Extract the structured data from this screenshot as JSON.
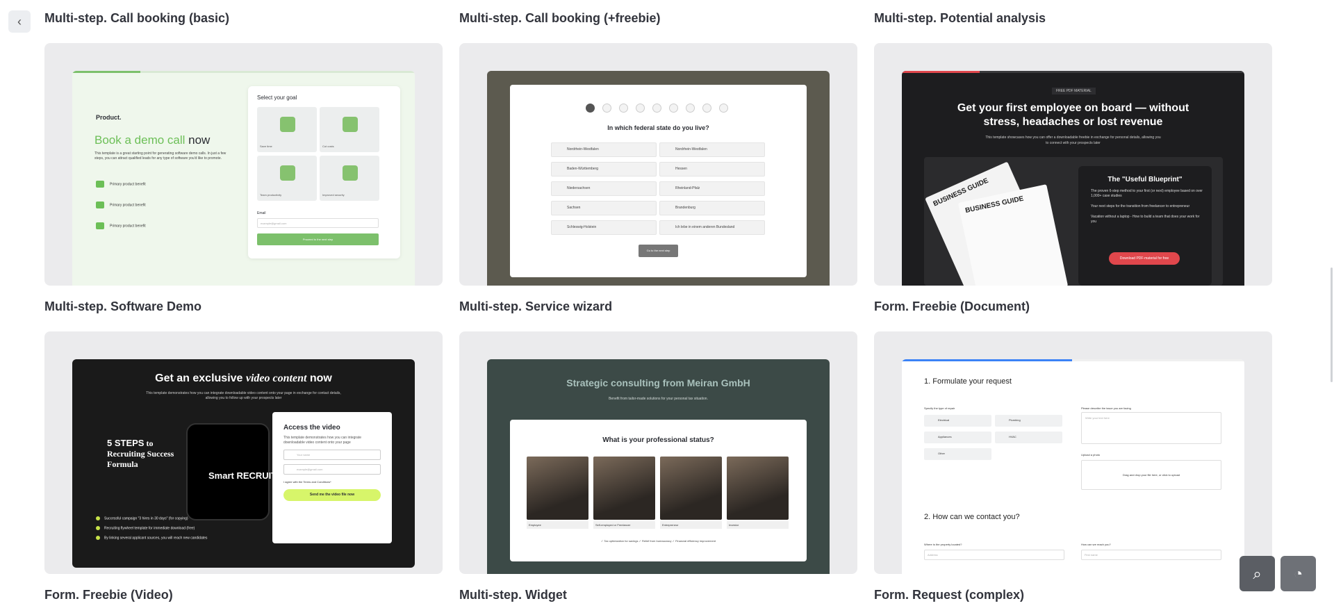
{
  "nav": {
    "back_icon": "chevron-left-icon",
    "back_glyph": "‹"
  },
  "titles_top": [
    "Multi-step. Call booking (basic)",
    "Multi-step. Call booking (+freebie)",
    "Multi-step. Potential analysis"
  ],
  "templates": [
    {
      "title": "Multi-step. Software Demo",
      "preview": {
        "logo": "Product.",
        "headline_pre": "Book a ",
        "headline_hl": "demo call",
        "headline_post": " now",
        "desc": "This template is a great starting point for generating software demo calls. In just a few steps, you can attract qualified leads for any type of software you'd like to promote.",
        "benefits": [
          "Primary product benefit",
          "Primary product benefit",
          "Primary product benefit"
        ],
        "panel_title": "Select your goal",
        "tiles": [
          "Save time",
          "Cut costs",
          "Team productivity",
          "Improved security"
        ],
        "email_label": "Email",
        "email_placeholder": "example@gmail.com",
        "cta": "Proceed to the next step"
      }
    },
    {
      "title": "Multi-step. Service wizard",
      "preview": {
        "question": "In which federal state do you live?",
        "steps": [
          "1",
          "2",
          "3",
          "4",
          "5",
          "6",
          "7",
          "8",
          "9"
        ],
        "options": [
          "Nordrhein-Westfalen",
          "Nordrhein-Westfalen",
          "Baden-Württemberg",
          "Hessen",
          "Niedersachsen",
          "Rheinland-Pfalz",
          "Sachsen",
          "Brandenburg",
          "Schleswig-Holstein",
          "Ich lebe in einem anderen Bundesland"
        ],
        "next": "Go to the next step"
      }
    },
    {
      "title": "Form. Freebie (Document)",
      "preview": {
        "tag": "FREE PDF MATERIAL",
        "headline": "Get your first employee on board — without stress, headaches or lost revenue",
        "sub": "This template showcases how you can offer a downloadable freebie in exchange for personal details, allowing you to connect with your prospects later",
        "card_title": "The \"Useful Blueprint\"",
        "bullets": [
          "The proven 6-step method to your first (or next) employee based on over 1,000+ case studies",
          "Your next steps for the transition from freelancer to entrepreneur",
          "Vacation without a laptop - How to build a team that does your work for you"
        ],
        "download": "Download PDF-material for free",
        "book_title": "BUSINESS GUIDE"
      }
    },
    {
      "title": "Form. Freebie (Video)",
      "preview": {
        "headline_pre": "Get an exclusive ",
        "headline_em": "video content",
        "headline_post": " now",
        "sub": "This template demonstrates how you can integrate downloadable video content onto your page in exchange for contact details, allowing you to follow up with your prospects later",
        "steps_title": "5 STEPS",
        "steps_sub": "to Recruiting Success Formula",
        "smart": "Smart RECRUITING",
        "form_title": "Access the video",
        "form_desc": "This template demonstrates how you can integrate downloadable video content onto your page",
        "name_placeholder": "Your name",
        "email_placeholder": "example@gmail.com",
        "agree": "I agree with the Terms and Conditions*",
        "send": "Send me the video file now",
        "bullets": [
          "Successful campaign \"3 hires in 30 days\" (for copying)",
          "Recruiting flywheel template for immediate download (free)",
          "By linking several applicant sources, you will reach new candidates"
        ]
      }
    },
    {
      "title": "Multi-step. Widget",
      "preview": {
        "headline_hl": "Strategic consulting",
        "headline_post": " from Meiran GmbH",
        "sub": "Benefit from tailor-made solutions for your personal tax situation.",
        "question": "What is your professional status?",
        "choices": [
          "Employee",
          "Self-employed or Freelancer",
          "Entrepreneur",
          "Investor"
        ],
        "footer": "✓ Tax optimization for savings   ✓ Relief from bureaucracy   ✓ Financial efficiency improvement"
      }
    },
    {
      "title": "Form. Request (complex)",
      "preview": {
        "section1": "1. Formulate your request",
        "repair_label": "Specify the type of repair",
        "repair_options": [
          "Electrical",
          "Plumbing",
          "Appliances",
          "HVAC",
          "Other"
        ],
        "issue_label": "Please describe the issue you are facing",
        "issue_placeholder": "Write your text here",
        "photo_label": "Upload a photo",
        "photo_text": "Drag and drop your file here, or click to upload",
        "section2": "2. How can we contact you?",
        "address_label": "Where is the property located?",
        "address_placeholder": "Address",
        "reach_label": "How can we reach you?",
        "reach_placeholder": "First name"
      }
    }
  ],
  "fab": {
    "search_icon": "search-icon",
    "search_glyph": "⌕",
    "chat_icon": "chat-icon",
    "chat_glyph": "◔"
  }
}
